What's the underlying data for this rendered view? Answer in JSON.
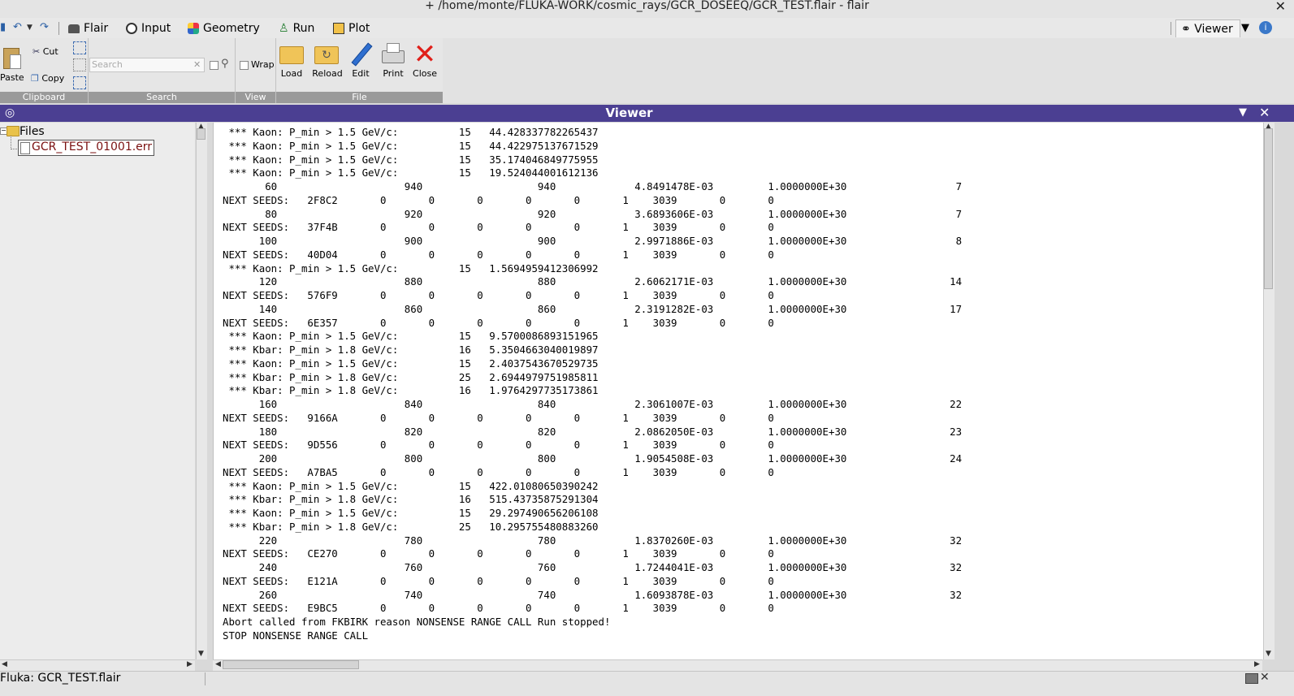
{
  "window": {
    "title": "+ /home/monte/FLUKA-WORK/cosmic_rays/GCR_DOSEEQ/GCR_TEST.flair - flair",
    "close_symbol": "✕"
  },
  "menu": {
    "items": [
      {
        "label": "Flair",
        "icon": "flair-icon"
      },
      {
        "label": "Input",
        "icon": "input-icon"
      },
      {
        "label": "Geometry",
        "icon": "geometry-icon"
      },
      {
        "label": "Run",
        "icon": "run-icon"
      },
      {
        "label": "Plot",
        "icon": "plot-icon"
      }
    ],
    "viewer_tab": "Viewer",
    "help_symbol": "i"
  },
  "ribbon": {
    "clipboard": {
      "paste": "Paste",
      "cut": "Cut",
      "copy": "Copy",
      "group": "Clipboard"
    },
    "search": {
      "placeholder": "Search",
      "group": "Search"
    },
    "view": {
      "wrap": "Wrap",
      "group": "View"
    },
    "file": {
      "load": "Load",
      "reload": "Reload",
      "edit": "Edit",
      "print": "Print",
      "close": "Close",
      "group": "File"
    }
  },
  "viewer": {
    "title": "Viewer"
  },
  "tree": {
    "root": "Files",
    "file": "GCR_TEST_01001.err"
  },
  "log_lines": [
    " *** Kaon: P_min > 1.5 GeV/c:          15   44.428337782265437",
    " *** Kaon: P_min > 1.5 GeV/c:          15   44.422975137671529",
    " *** Kaon: P_min > 1.5 GeV/c:          15   35.174046849775955",
    " *** Kaon: P_min > 1.5 GeV/c:          15   19.524044001612136",
    "       60                     940                   940             4.8491478E-03         1.0000000E+30                  7",
    "NEXT SEEDS:   2F8C2       0       0       0       0       0       1    3039       0       0",
    "       80                     920                   920             3.6893606E-03         1.0000000E+30                  7",
    "NEXT SEEDS:   37F4B       0       0       0       0       0       1    3039       0       0",
    "      100                     900                   900             2.9971886E-03         1.0000000E+30                  8",
    "NEXT SEEDS:   40D04       0       0       0       0       0       1    3039       0       0",
    " *** Kaon: P_min > 1.5 GeV/c:          15   1.5694959412306992",
    "      120                     880                   880             2.6062171E-03         1.0000000E+30                 14",
    "NEXT SEEDS:   576F9       0       0       0       0       0       1    3039       0       0",
    "      140                     860                   860             2.3191282E-03         1.0000000E+30                 17",
    "NEXT SEEDS:   6E357       0       0       0       0       0       1    3039       0       0",
    " *** Kaon: P_min > 1.5 GeV/c:          15   9.5700086893151965",
    " *** Kbar: P_min > 1.8 GeV/c:          16   5.3504663040019897",
    " *** Kaon: P_min > 1.5 GeV/c:          15   2.4037543670529735",
    " *** Kbar: P_min > 1.8 GeV/c:          25   2.6944979751985811",
    " *** Kbar: P_min > 1.8 GeV/c:          16   1.9764297735173861",
    "      160                     840                   840             2.3061007E-03         1.0000000E+30                 22",
    "NEXT SEEDS:   9166A       0       0       0       0       0       1    3039       0       0",
    "      180                     820                   820             2.0862050E-03         1.0000000E+30                 23",
    "NEXT SEEDS:   9D556       0       0       0       0       0       1    3039       0       0",
    "      200                     800                   800             1.9054508E-03         1.0000000E+30                 24",
    "NEXT SEEDS:   A7BA5       0       0       0       0       0       1    3039       0       0",
    " *** Kaon: P_min > 1.5 GeV/c:          15   422.01080650390242",
    " *** Kbar: P_min > 1.8 GeV/c:          16   515.43735875291304",
    " *** Kaon: P_min > 1.5 GeV/c:          15   29.297490656206108",
    " *** Kbar: P_min > 1.8 GeV/c:          25   10.295755480883260",
    "      220                     780                   780             1.8370260E-03         1.0000000E+30                 32",
    "NEXT SEEDS:   CE270       0       0       0       0       0       1    3039       0       0",
    "      240                     760                   760             1.7244041E-03         1.0000000E+30                 32",
    "NEXT SEEDS:   E121A       0       0       0       0       0       1    3039       0       0",
    "      260                     740                   740             1.6093878E-03         1.0000000E+30                 32",
    "NEXT SEEDS:   E9BC5       0       0       0       0       0       1    3039       0       0",
    "Abort called from FKBIRK reason NONSENSE RANGE CALL Run stopped!",
    "STOP NONSENSE RANGE CALL"
  ],
  "status": {
    "text": "Fluka: GCR_TEST.flair"
  },
  "colors": {
    "viewer_bar": "#4b3f92",
    "file_label": "#7a1010",
    "help_icon": "#3a78c9"
  }
}
